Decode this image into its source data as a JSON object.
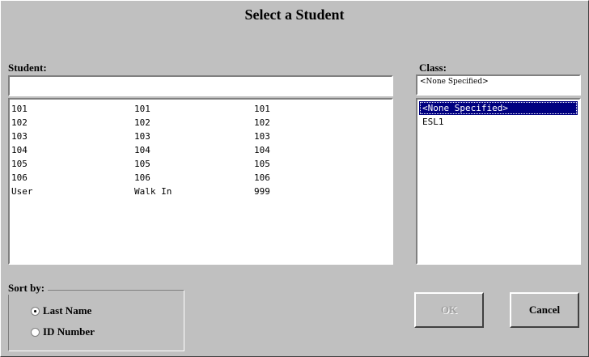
{
  "dialog": {
    "title": "Select a Student"
  },
  "student": {
    "label": "Student:",
    "search_value": "",
    "rows": [
      [
        "101",
        "101",
        "101"
      ],
      [
        "102",
        "102",
        "102"
      ],
      [
        "103",
        "103",
        "103"
      ],
      [
        "104",
        "104",
        "104"
      ],
      [
        "105",
        "105",
        "105"
      ],
      [
        "106",
        "106",
        "106"
      ],
      [
        "User",
        "Walk In",
        "999"
      ]
    ]
  },
  "class": {
    "label": "Class:",
    "selected_value": "<None Specified>",
    "items": [
      "<None Specified>",
      "ESL1"
    ],
    "selected_index": 0
  },
  "sort": {
    "label": "Sort by:",
    "options": [
      "Last Name",
      "ID Number"
    ],
    "selected_index": 0
  },
  "buttons": {
    "ok_label": "OK",
    "cancel_label": "Cancel"
  },
  "colors": {
    "background": "#c0c0c0",
    "selection": "#000080"
  }
}
